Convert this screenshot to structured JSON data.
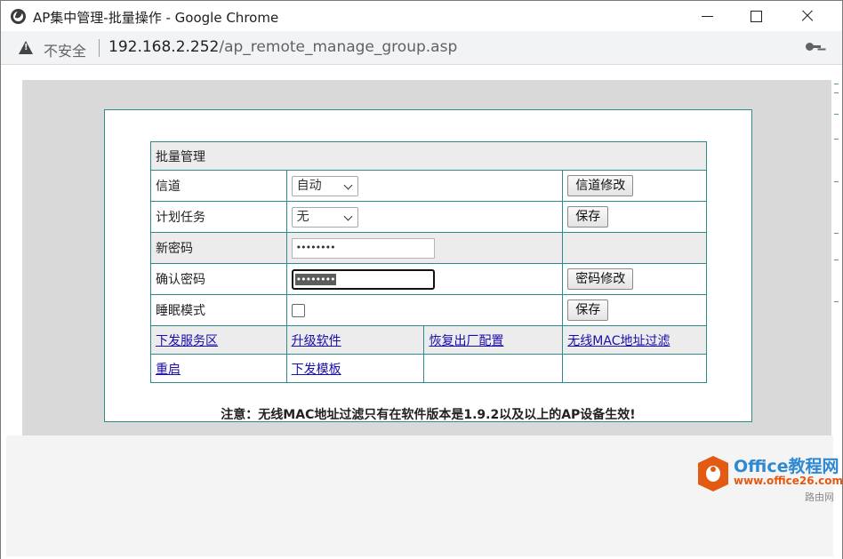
{
  "window": {
    "title": "AP集中管理-批量操作 - Google Chrome",
    "controls": [
      "minimize",
      "maximize",
      "close"
    ]
  },
  "addressbar": {
    "security_label": "不安全",
    "url_host": "192.168.2.252",
    "url_path": "/ap_remote_manage_group.asp"
  },
  "form": {
    "header": "批量管理",
    "rows": [
      {
        "label": "信道",
        "control": "select",
        "value": "自动",
        "button": "信道修改"
      },
      {
        "label": "计划任务",
        "control": "select",
        "value": "无",
        "button": "保存"
      },
      {
        "label": "新密码",
        "control": "password",
        "value": "••••••••",
        "button": ""
      },
      {
        "label": "确认密码",
        "control": "password",
        "value": "••••••••",
        "button": "密码修改"
      },
      {
        "label": "睡眠模式",
        "control": "checkbox",
        "checked": false,
        "button": "保存"
      }
    ],
    "links": [
      [
        "下发服务区",
        "升级软件",
        "恢复出厂配置",
        "无线MAC地址过滤"
      ],
      [
        "重启",
        "下发模板",
        "",
        ""
      ]
    ],
    "note": "注意：无线MAC地址过滤只有在软件版本是1.9.2以及以上的AP设备生效!"
  },
  "watermark": {
    "brand": "Office教程网",
    "url": "www.office26.com",
    "extra": "路由网"
  }
}
